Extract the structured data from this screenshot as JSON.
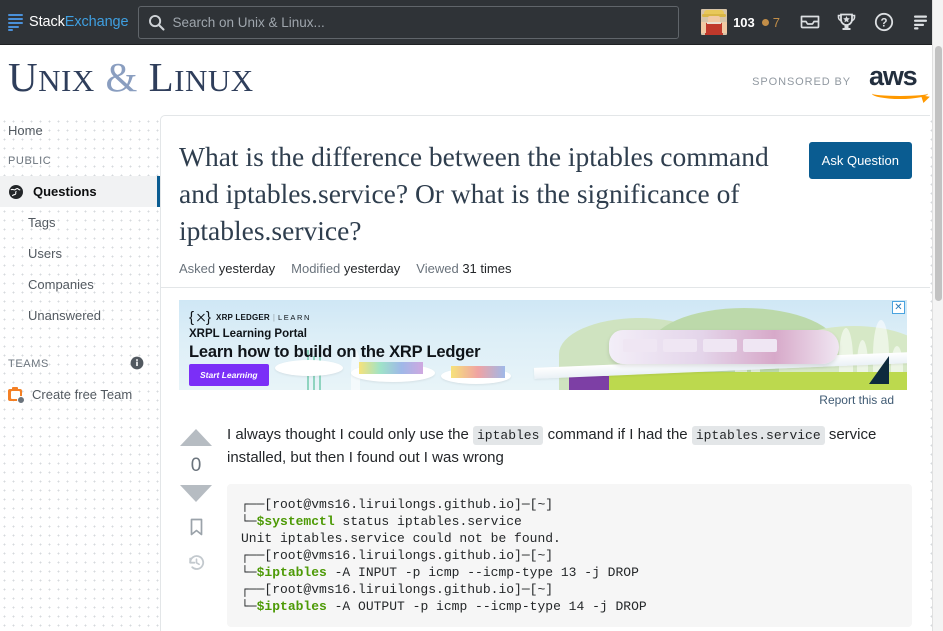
{
  "topbar": {
    "logo": {
      "part1": "Stack",
      "part2": "Exchange",
      "icon": "stack-logo-icon"
    },
    "search": {
      "placeholder": "Search on Unix & Linux...",
      "value": "",
      "icon": "search-icon"
    },
    "reputation": "103",
    "badge_count": "7",
    "icons": [
      "inbox-icon",
      "trophy-icon",
      "help-icon",
      "site-switcher-icon"
    ]
  },
  "site_header": {
    "logo_part1": "U",
    "logo_part1_rest": "NIX",
    "amp": "&",
    "logo_part2": "L",
    "logo_part2_rest": "INUX",
    "sponsored_label": "SPONSORED BY",
    "sponsor_name": "aws"
  },
  "sidebar": {
    "home_label": "Home",
    "public_header": "PUBLIC",
    "items": [
      {
        "label": "Questions",
        "icon": "globe-icon",
        "active": true
      },
      {
        "label": "Tags",
        "active": false
      },
      {
        "label": "Users",
        "active": false
      },
      {
        "label": "Companies",
        "active": false
      },
      {
        "label": "Unanswered",
        "active": false
      }
    ],
    "teams_header": "TEAMS",
    "teams_info_icon": "info-icon",
    "create_team_label": "Create free Team"
  },
  "question": {
    "title": "What is the difference between the iptables command and iptables.service? Or what is the significance of iptables.service?",
    "ask_button": "Ask Question",
    "meta": [
      {
        "label": "Asked",
        "value": "yesterday"
      },
      {
        "label": "Modified",
        "value": "yesterday"
      },
      {
        "label": "Viewed",
        "value": "31 times"
      }
    ],
    "votes": "0",
    "body_parts": {
      "p1": "I always thought I could only use the ",
      "code1": "iptables",
      "p2": " command if I had the ",
      "code2": "iptables.service",
      "p3": " service installed, but then I found out I was wrong"
    },
    "code_lines": [
      {
        "prefix": "┌──[root@vms16.liruilongs.github.io]─[~]",
        "green": "",
        "rest": ""
      },
      {
        "prefix": "└─",
        "green": "$systemctl",
        "rest": " status iptables.service"
      },
      {
        "prefix": "Unit iptables.service could not be found.",
        "green": "",
        "rest": ""
      },
      {
        "prefix": "┌──[root@vms16.liruilongs.github.io]─[~]",
        "green": "",
        "rest": ""
      },
      {
        "prefix": "└─",
        "green": "$iptables",
        "rest": " -A INPUT -p icmp --icmp-type 13 -j DROP"
      },
      {
        "prefix": "┌──[root@vms16.liruilongs.github.io]─[~]",
        "green": "",
        "rest": ""
      },
      {
        "prefix": "└─",
        "green": "$iptables",
        "rest": " -A OUTPUT -p icmp --icmp-type 14 -j DROP"
      }
    ],
    "vote_icons": [
      "upvote-arrow",
      "downvote-arrow",
      "bookmark-icon",
      "history-icon"
    ]
  },
  "ad": {
    "logo_name": "XRP LEDGER",
    "logo_sep": "|",
    "logo_learn": "LEARN",
    "line1": "XRPL Learning Portal",
    "line2": "Learn how to build on the XRP Ledger",
    "cta": "Start Learning",
    "close": "✕",
    "report_label": "Report this ad"
  },
  "colors": {
    "topbar_bg": "#2f3337",
    "accent_blue": "#0a5c91",
    "se_blue": "#3f9fe0",
    "site_navy": "#2f3e5b",
    "aws_orange": "#ff9900",
    "code_green": "#4d9a06",
    "ad_purple": "#7b2ff7",
    "teams_orange": "#f48024"
  }
}
